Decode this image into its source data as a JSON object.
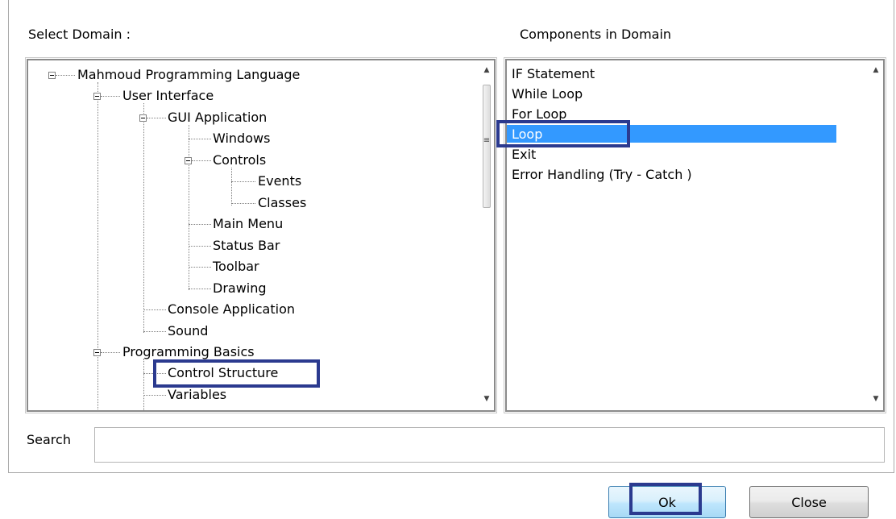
{
  "labels": {
    "select_domain": "Select Domain :",
    "components_in_domain": "Components in Domain",
    "search": "Search"
  },
  "tree": {
    "root": "Mahmoud Programming Language",
    "user_interface": "User Interface",
    "gui_application": "GUI Application",
    "windows": "Windows",
    "controls": "Controls",
    "events": "Events",
    "classes": "Classes",
    "main_menu": "Main Menu",
    "status_bar": "Status Bar",
    "toolbar": "Toolbar",
    "drawing": "Drawing",
    "console_application": "Console Application",
    "sound": "Sound",
    "programming_basics": "Programming Basics",
    "control_structure": "Control Structure",
    "variables": "Variables"
  },
  "components": [
    "IF Statement",
    "While Loop",
    "For Loop",
    "Loop",
    "Exit",
    "Error Handling (Try - Catch )"
  ],
  "selected_component": "Loop",
  "search": {
    "value": ""
  },
  "buttons": {
    "ok": "Ok",
    "close": "Close"
  },
  "colors": {
    "selection": "#3399ff",
    "highlight_box": "#2b3a8f"
  }
}
